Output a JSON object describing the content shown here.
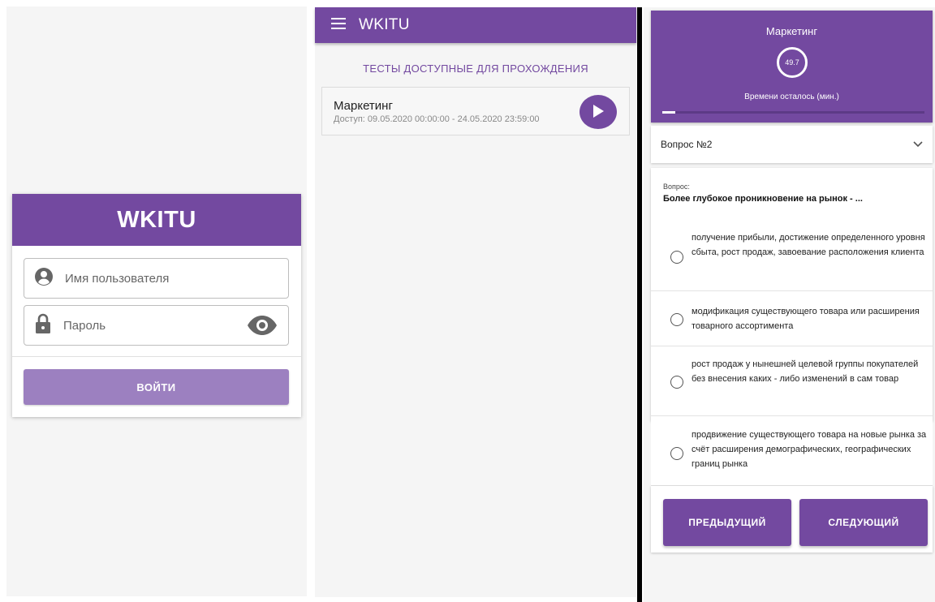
{
  "login": {
    "title": "WKITU",
    "username_placeholder": "Имя пользователя",
    "password_placeholder": "Пароль",
    "submit_label": "ВОЙТИ"
  },
  "tests": {
    "app_title": "WKITU",
    "section_title": "ТЕСТЫ ДОСТУПНЫЕ ДЛЯ ПРОХОЖДЕНИЯ",
    "items": [
      {
        "name": "Маркетинг",
        "access": "Доступ: 09.05.2020 00:00:00 - 24.05.2020 23:59:00"
      }
    ]
  },
  "quiz": {
    "subject": "Маркетинг",
    "time_left": "49.7",
    "time_left_label": "Времени осталось (мин.)",
    "progress_fraction": 0.05,
    "question_selector": "Вопрос №2",
    "question_label": "Вопрос:",
    "question_text": "Более глубокое проникновение на рынок - ...",
    "options": [
      "получение прибыли, достижение определенного уровня сбыта, рост продаж, завоевание расположения клиента",
      "модификация существующего товара или расширения товарного ассортимента",
      "рост продаж у нынешней целевой группы покупателей без внесения каких - либо изменений в сам товар",
      "продвижение существующего товара на новые рынка за счёт расширения демографических, географических границ рынка"
    ],
    "prev_label": "ПРЕДЫДУЩИЙ",
    "next_label": "СЛЕДУЮЩИЙ"
  },
  "colors": {
    "brand": "#7349a0",
    "brand_disabled": "#9c80c0"
  }
}
